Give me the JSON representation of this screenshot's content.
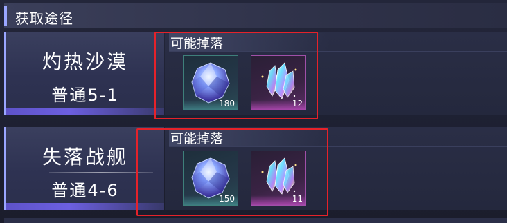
{
  "header": {
    "title": "获取途径"
  },
  "sources": [
    {
      "location": "灼热沙漠",
      "stage": "普通5-1",
      "drops_label": "可能掉落",
      "items": [
        {
          "icon": "blue-gem-icon",
          "count": "180",
          "frame": "teal"
        },
        {
          "icon": "rainbow-crystal-icon",
          "count": "12",
          "frame": "pink"
        }
      ]
    },
    {
      "location": "失落战舰",
      "stage": "普通4-6",
      "drops_label": "可能掉落",
      "items": [
        {
          "icon": "blue-gem-icon",
          "count": "150",
          "frame": "teal"
        },
        {
          "icon": "rainbow-crystal-icon",
          "count": "11",
          "frame": "pink"
        }
      ]
    }
  ],
  "colors": {
    "highlight_box": "#e5222a",
    "accent_purple": "#6c5fe0",
    "teal_frame": "#3e7f7a",
    "pink_frame": "#a050a8"
  }
}
